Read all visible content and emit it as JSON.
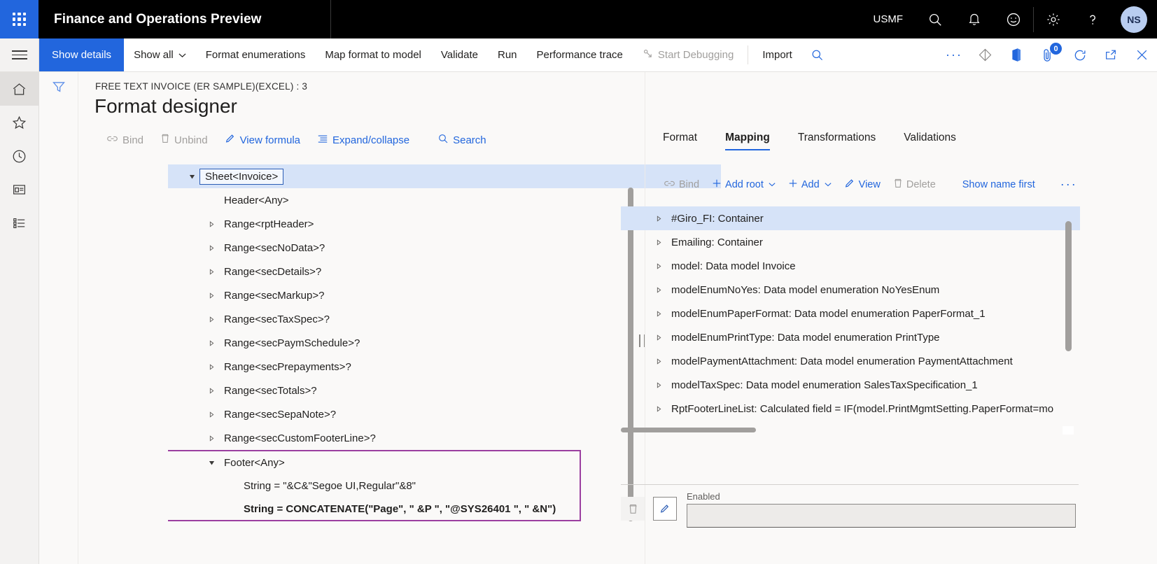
{
  "topbar": {
    "app_title": "Finance and Operations Preview",
    "company": "USMF",
    "icons": [
      {
        "name": "search-icon",
        "glyph": "search"
      },
      {
        "name": "notifications-bell-icon",
        "glyph": "bell"
      },
      {
        "name": "feedback-smiley-icon",
        "glyph": "smiley"
      },
      {
        "name": "settings-gear-icon",
        "glyph": "gear"
      },
      {
        "name": "help-question-icon",
        "glyph": "question"
      }
    ],
    "avatar_initials": "NS"
  },
  "actionbar": {
    "show_details": "Show details",
    "items": [
      {
        "label": "Show all",
        "has_caret": true,
        "disabled": false
      },
      {
        "label": "Format enumerations",
        "has_caret": false,
        "disabled": false
      },
      {
        "label": "Map format to model",
        "has_caret": false,
        "disabled": false
      },
      {
        "label": "Validate",
        "has_caret": false,
        "disabled": false
      },
      {
        "label": "Run",
        "has_caret": false,
        "disabled": false
      },
      {
        "label": "Performance trace",
        "has_caret": false,
        "disabled": false
      },
      {
        "label": "Start Debugging",
        "has_caret": false,
        "disabled": true
      },
      {
        "label": "Import",
        "has_caret": false,
        "disabled": false
      }
    ],
    "overflow_label": "···",
    "attachments_badge": "0"
  },
  "navrail": {
    "items": [
      {
        "name": "home-icon",
        "label": "Home"
      },
      {
        "name": "favorites-star-icon",
        "label": "Favorites"
      },
      {
        "name": "recent-clock-icon",
        "label": "Recent"
      },
      {
        "name": "workspaces-icon",
        "label": "Workspaces"
      },
      {
        "name": "modules-list-icon",
        "label": "Modules"
      }
    ]
  },
  "page": {
    "breadcrumb": "FREE TEXT INVOICE (ER SAMPLE)(EXCEL) : 3",
    "title": "Format designer"
  },
  "left_toolbar": [
    {
      "label": "Bind",
      "icon": "bind-link-icon",
      "disabled": true
    },
    {
      "label": "Unbind",
      "icon": "unbind-trash-icon",
      "disabled": true
    },
    {
      "label": "View formula",
      "icon": "pencil-icon",
      "disabled": false
    },
    {
      "label": "Expand/collapse",
      "icon": "list-icon",
      "disabled": false
    },
    {
      "label": "Search",
      "icon": "search-icon",
      "disabled": false
    }
  ],
  "format_tree": [
    {
      "label": "Sheet<Invoice>",
      "indent": 0,
      "twisty": "expanded",
      "selected": true,
      "boxed": true,
      "bold": false
    },
    {
      "label": "Header<Any>",
      "indent": 1,
      "twisty": "none",
      "selected": false,
      "boxed": false,
      "bold": false
    },
    {
      "label": "Range<rptHeader>",
      "indent": 1,
      "twisty": "collapsed",
      "selected": false,
      "boxed": false,
      "bold": false
    },
    {
      "label": "Range<secNoData>?",
      "indent": 1,
      "twisty": "collapsed",
      "selected": false,
      "boxed": false,
      "bold": false
    },
    {
      "label": "Range<secDetails>?",
      "indent": 1,
      "twisty": "collapsed",
      "selected": false,
      "boxed": false,
      "bold": false
    },
    {
      "label": "Range<secMarkup>?",
      "indent": 1,
      "twisty": "collapsed",
      "selected": false,
      "boxed": false,
      "bold": false
    },
    {
      "label": "Range<secTaxSpec>?",
      "indent": 1,
      "twisty": "collapsed",
      "selected": false,
      "boxed": false,
      "bold": false
    },
    {
      "label": "Range<secPaymSchedule>?",
      "indent": 1,
      "twisty": "collapsed",
      "selected": false,
      "boxed": false,
      "bold": false
    },
    {
      "label": "Range<secPrepayments>?",
      "indent": 1,
      "twisty": "collapsed",
      "selected": false,
      "boxed": false,
      "bold": false
    },
    {
      "label": "Range<secTotals>?",
      "indent": 1,
      "twisty": "collapsed",
      "selected": false,
      "boxed": false,
      "bold": false
    },
    {
      "label": "Range<secSepaNote>?",
      "indent": 1,
      "twisty": "collapsed",
      "selected": false,
      "boxed": false,
      "bold": false
    },
    {
      "label": "Range<secCustomFooterLine>?",
      "indent": 1,
      "twisty": "collapsed",
      "selected": false,
      "boxed": false,
      "bold": false
    },
    {
      "label": "Footer<Any>",
      "indent": 1,
      "twisty": "expanded",
      "selected": false,
      "boxed": false,
      "bold": false
    },
    {
      "label": "String = \"&C&\"Segoe UI,Regular\"&8\"",
      "indent": 2,
      "twisty": "none",
      "selected": false,
      "boxed": false,
      "bold": false
    },
    {
      "label": "String = CONCATENATE(\"Page\", \" &P \", \"@SYS26401 \", \" &N\")",
      "indent": 2,
      "twisty": "none",
      "selected": false,
      "boxed": false,
      "bold": true
    }
  ],
  "highlight": {
    "color": "#9b3fa0",
    "start_index": 12,
    "end_index": 14
  },
  "right_panel": {
    "tabs": [
      {
        "label": "Format",
        "active": false
      },
      {
        "label": "Mapping",
        "active": true
      },
      {
        "label": "Transformations",
        "active": false
      },
      {
        "label": "Validations",
        "active": false
      }
    ],
    "toolbar": [
      {
        "label": "Bind",
        "icon": "bind-link-icon",
        "disabled": true,
        "caret": false
      },
      {
        "label": "Add root",
        "icon": "plus-icon",
        "disabled": false,
        "caret": true
      },
      {
        "label": "Add",
        "icon": "plus-icon",
        "disabled": false,
        "caret": true
      },
      {
        "label": "View",
        "icon": "pencil-icon",
        "disabled": false,
        "caret": false
      },
      {
        "label": "Delete",
        "icon": "trash-icon",
        "disabled": true,
        "caret": false
      },
      {
        "label": "Show name first",
        "icon": "",
        "disabled": false,
        "caret": false
      },
      {
        "label": "···",
        "icon": "",
        "disabled": false,
        "caret": false
      }
    ],
    "rows": [
      {
        "label": "#Giro_FI: Container",
        "selected": true
      },
      {
        "label": "Emailing: Container",
        "selected": false
      },
      {
        "label": "model: Data model Invoice",
        "selected": false
      },
      {
        "label": "modelEnumNoYes: Data model enumeration NoYesEnum",
        "selected": false
      },
      {
        "label": "modelEnumPaperFormat: Data model enumeration PaperFormat_1",
        "selected": false
      },
      {
        "label": "modelEnumPrintType: Data model enumeration PrintType",
        "selected": false
      },
      {
        "label": "modelPaymentAttachment: Data model enumeration PaymentAttachment",
        "selected": false
      },
      {
        "label": "modelTaxSpec: Data model enumeration SalesTaxSpecification_1",
        "selected": false
      },
      {
        "label": "RptFooterLineList: Calculated field = IF(model.PrintMgmtSetting.PaperFormat=mo",
        "selected": false
      }
    ],
    "detail": {
      "delete_icon": "trash-icon",
      "edit_icon": "pencil-icon",
      "field_label": "Enabled",
      "field_value": ""
    }
  },
  "colors": {
    "accent": "#2266dd",
    "topbar_bg": "#000000",
    "selection": "#d6e3f8",
    "highlight_box": "#9b3fa0",
    "disabled_text": "#a19f9d"
  }
}
